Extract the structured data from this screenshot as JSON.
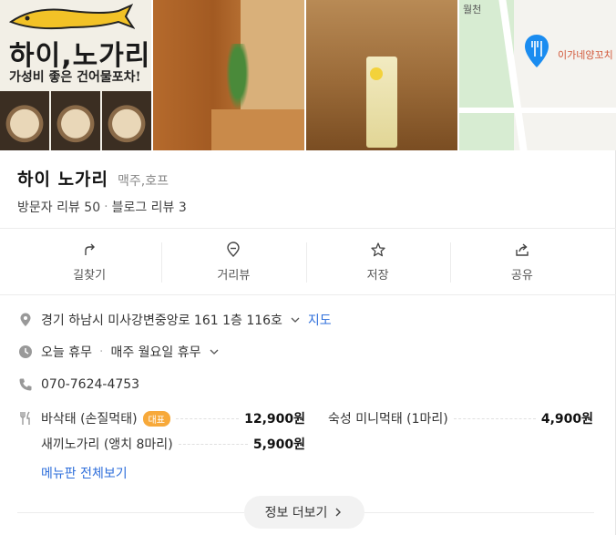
{
  "photos": {
    "logo": {
      "title": "하이,노가리",
      "subtitle": "가성비 좋은 건어물포차!"
    },
    "map": {
      "labels": [
        "월천",
        "이가네양꼬치"
      ]
    }
  },
  "place": {
    "name": "하이 노가리",
    "category": "맥주,호프",
    "visitor_reviews": "방문자 리뷰 50",
    "blog_reviews": "블로그 리뷰 3"
  },
  "actions": [
    {
      "label": "길찾기",
      "icon": "directions-icon"
    },
    {
      "label": "거리뷰",
      "icon": "streetview-icon"
    },
    {
      "label": "저장",
      "icon": "star-icon"
    },
    {
      "label": "공유",
      "icon": "share-icon"
    }
  ],
  "info": {
    "address": "경기 하남시 미사강변중앙로 161 1층 116호",
    "map_link": "지도",
    "hours_status": "오늘 휴무",
    "hours_detail": "매주 월요일 휴무",
    "phone": "070-7624-4753"
  },
  "menu": {
    "items": [
      {
        "name": "바삭태 (손질먹태)",
        "badge": "대표",
        "price": "12,900원"
      },
      {
        "name": "숙성 미니먹태 (1마리)",
        "price": "4,900원"
      },
      {
        "name": "새끼노가리 (앵치 8마리)",
        "price": "5,900원"
      }
    ],
    "view_all": "메뉴판 전체보기"
  },
  "more_button": "정보 더보기",
  "colors": {
    "link": "#2f6fdb",
    "badge": "#f7a93a",
    "map_pin": "#1a8cf0"
  }
}
